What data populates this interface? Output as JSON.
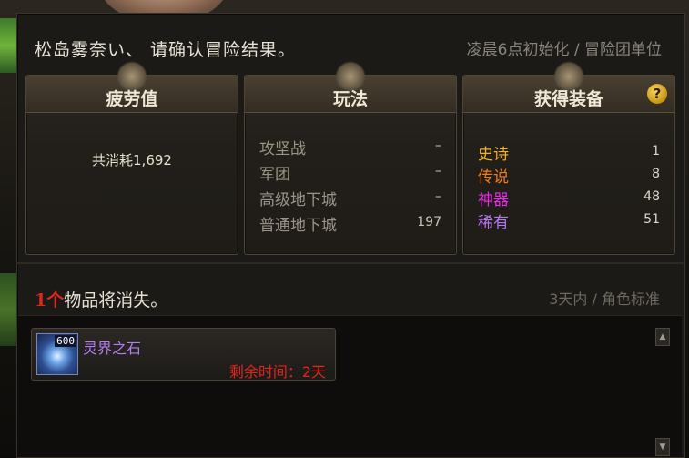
{
  "header": {
    "title": "松岛雾奈い、 请确认冒险结果。",
    "reset_note": "凌晨6点初始化 / 冒险团单位"
  },
  "fatigue": {
    "title": "疲劳值",
    "consumed": "共消耗1,692"
  },
  "modes": {
    "title": "玩法",
    "rows": [
      {
        "name": "攻坚战",
        "value": "–"
      },
      {
        "name": "军团",
        "value": "–"
      },
      {
        "name": "高级地下城",
        "value": "–"
      },
      {
        "name": "普通地下城",
        "value": "197"
      }
    ]
  },
  "equipment": {
    "title": "获得装备",
    "help": "?",
    "rows": [
      {
        "name": "史诗",
        "value": "1",
        "color": "#f5b31a"
      },
      {
        "name": "传说",
        "value": "8",
        "color": "#f07a1a"
      },
      {
        "name": "神器",
        "value": "48",
        "color": "#e52ee6"
      },
      {
        "name": "稀有",
        "value": "51",
        "color": "#b477f0"
      }
    ]
  },
  "expiring": {
    "count": "1个",
    "label": "物品将消失。",
    "note": "3天内 / 角色标准",
    "items": [
      {
        "name": "灵界之石",
        "level": "600",
        "time": "剩余时间：2天",
        "icon": "crystal-icon"
      }
    ]
  },
  "scrollbar": {
    "up": "▲",
    "down": "▼"
  }
}
